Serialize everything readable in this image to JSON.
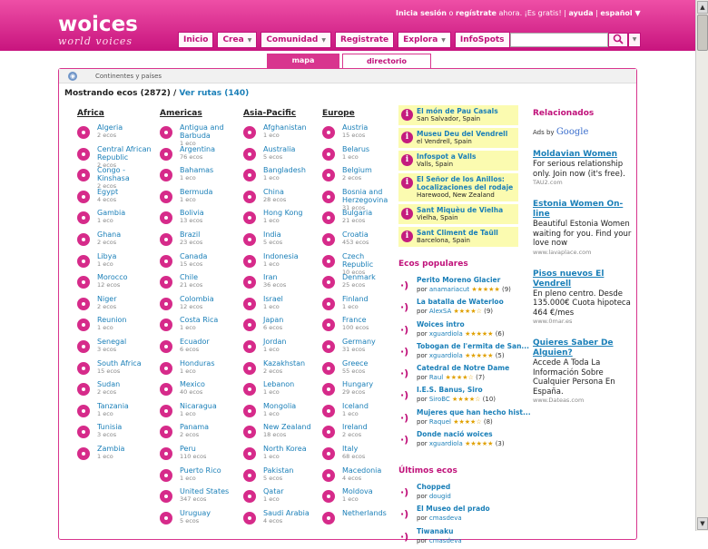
{
  "header": {
    "logo_main": "woices",
    "logo_sub": "world voices"
  },
  "toplinks": {
    "login": "Inicia sesión",
    "o": " o ",
    "register": "regístrate",
    "tail": " ahora. ¡Es gratis!",
    "sep1": " | ",
    "help": "ayuda",
    "sep2": " | ",
    "lang": "español ▼"
  },
  "nav": [
    {
      "label": "Inicio",
      "dd": false
    },
    {
      "label": "Crea",
      "dd": true
    },
    {
      "label": "Comunidad",
      "dd": true
    },
    {
      "label": "Registrate",
      "dd": false
    },
    {
      "label": "Explora",
      "dd": true
    },
    {
      "label": "InfoSpots",
      "dd": false
    }
  ],
  "search": {
    "value": "",
    "placeholder": ""
  },
  "tabs": {
    "map": "mapa",
    "directory": "directorio"
  },
  "breadcrumb": "Continentes y países",
  "summary": {
    "prefix": "Mostrando ecos (2872) / ",
    "link": "Ver rutas (140)"
  },
  "continents": [
    {
      "name": "Africa",
      "countries": [
        {
          "n": "Algeria",
          "c": "2 ecos"
        },
        {
          "n": "Central African Republic",
          "c": "2 ecos"
        },
        {
          "n": "Congo - Kinshasa",
          "c": "2 ecos"
        },
        {
          "n": "Egypt",
          "c": "4 ecos"
        },
        {
          "n": "Gambia",
          "c": "1 eco"
        },
        {
          "n": "Ghana",
          "c": "2 ecos"
        },
        {
          "n": "Libya",
          "c": "1 eco"
        },
        {
          "n": "Morocco",
          "c": "12 ecos"
        },
        {
          "n": "Niger",
          "c": "2 ecos"
        },
        {
          "n": "Reunion",
          "c": "1 eco"
        },
        {
          "n": "Senegal",
          "c": "3 ecos"
        },
        {
          "n": "South Africa",
          "c": "15 ecos"
        },
        {
          "n": "Sudan",
          "c": "2 ecos"
        },
        {
          "n": "Tanzania",
          "c": "1 eco"
        },
        {
          "n": "Tunisia",
          "c": "3 ecos"
        },
        {
          "n": "Zambia",
          "c": "1 eco"
        }
      ]
    },
    {
      "name": "Americas",
      "countries": [
        {
          "n": "Antigua and Barbuda",
          "c": "1 eco"
        },
        {
          "n": "Argentina",
          "c": "76 ecos"
        },
        {
          "n": "Bahamas",
          "c": "1 eco"
        },
        {
          "n": "Bermuda",
          "c": "1 eco"
        },
        {
          "n": "Bolivia",
          "c": "13 ecos"
        },
        {
          "n": "Brazil",
          "c": "23 ecos"
        },
        {
          "n": "Canada",
          "c": "15 ecos"
        },
        {
          "n": "Chile",
          "c": "21 ecos"
        },
        {
          "n": "Colombia",
          "c": "12 ecos"
        },
        {
          "n": "Costa Rica",
          "c": "1 eco"
        },
        {
          "n": "Ecuador",
          "c": "6 ecos"
        },
        {
          "n": "Honduras",
          "c": "1 eco"
        },
        {
          "n": "Mexico",
          "c": "40 ecos"
        },
        {
          "n": "Nicaragua",
          "c": "1 eco"
        },
        {
          "n": "Panama",
          "c": "2 ecos"
        },
        {
          "n": "Peru",
          "c": "110 ecos"
        },
        {
          "n": "Puerto Rico",
          "c": "1 eco"
        },
        {
          "n": "United States",
          "c": "347 ecos"
        },
        {
          "n": "Uruguay",
          "c": "5 ecos"
        }
      ]
    },
    {
      "name": "Asia-Pacific",
      "countries": [
        {
          "n": "Afghanistan",
          "c": "1 eco"
        },
        {
          "n": "Australia",
          "c": "5 ecos"
        },
        {
          "n": "Bangladesh",
          "c": "1 eco"
        },
        {
          "n": "China",
          "c": "28 ecos"
        },
        {
          "n": "Hong Kong",
          "c": "1 eco"
        },
        {
          "n": "India",
          "c": "5 ecos"
        },
        {
          "n": "Indonesia",
          "c": "1 eco"
        },
        {
          "n": "Iran",
          "c": "36 ecos"
        },
        {
          "n": "Israel",
          "c": "1 eco"
        },
        {
          "n": "Japan",
          "c": "6 ecos"
        },
        {
          "n": "Jordan",
          "c": "1 eco"
        },
        {
          "n": "Kazakhstan",
          "c": "2 ecos"
        },
        {
          "n": "Lebanon",
          "c": "1 eco"
        },
        {
          "n": "Mongolia",
          "c": "1 eco"
        },
        {
          "n": "New Zealand",
          "c": "18 ecos"
        },
        {
          "n": "North Korea",
          "c": "1 eco"
        },
        {
          "n": "Pakistan",
          "c": "5 ecos"
        },
        {
          "n": "Qatar",
          "c": "1 eco"
        },
        {
          "n": "Saudi Arabia",
          "c": "4 ecos"
        }
      ]
    },
    {
      "name": "Europe",
      "countries": [
        {
          "n": "Austria",
          "c": "15 ecos"
        },
        {
          "n": "Belarus",
          "c": "1 eco"
        },
        {
          "n": "Belgium",
          "c": "2 ecos"
        },
        {
          "n": "Bosnia and Herzegovina",
          "c": "31 ecos"
        },
        {
          "n": "Bulgaria",
          "c": "21 ecos"
        },
        {
          "n": "Croatia",
          "c": "453 ecos"
        },
        {
          "n": "Czech Republic",
          "c": "10 ecos"
        },
        {
          "n": "Denmark",
          "c": "25 ecos"
        },
        {
          "n": "Finland",
          "c": "1 eco"
        },
        {
          "n": "France",
          "c": "100 ecos"
        },
        {
          "n": "Germany",
          "c": "31 ecos"
        },
        {
          "n": "Greece",
          "c": "55 ecos"
        },
        {
          "n": "Hungary",
          "c": "29 ecos"
        },
        {
          "n": "Iceland",
          "c": "1 eco"
        },
        {
          "n": "Ireland",
          "c": "2 ecos"
        },
        {
          "n": "Italy",
          "c": "68 ecos"
        },
        {
          "n": "Macedonia",
          "c": "4 ecos"
        },
        {
          "n": "Moldova",
          "c": "1 eco"
        },
        {
          "n": "Netherlands",
          "c": ""
        }
      ]
    }
  ],
  "infospots": [
    {
      "t": "El món de Pau Casals",
      "l": "San Salvador, Spain"
    },
    {
      "t": "Museu Deu del Vendrell",
      "l": "el Vendrell, Spain"
    },
    {
      "t": "Infospot a Valls",
      "l": "Valls, Spain"
    },
    {
      "t": "El Señor de los Anillos: Localizaciones del rodaje",
      "l": "Harewood, New Zealand"
    },
    {
      "t": "Sant Miquèu de Vielha",
      "l": "Vielha, Spain"
    },
    {
      "t": "Sant Climent de Taüll",
      "l": "Barcelona, Spain"
    }
  ],
  "popular": {
    "title": "Ecos populares",
    "items": [
      {
        "t": "Perito Moreno Glacier",
        "by": "por",
        "u": "anamariacut",
        "s": "★★★★★",
        "n": "(9)"
      },
      {
        "t": "La batalla de Waterloo",
        "by": "por",
        "u": "AlexSA",
        "s": "★★★★☆",
        "n": "(9)"
      },
      {
        "t": "Woices intro",
        "by": "por",
        "u": "xguardiola",
        "s": "★★★★★",
        "n": "(6)"
      },
      {
        "t": "Tobogan de l'ermita de San...",
        "by": "por",
        "u": "xguardiola",
        "s": "★★★★★",
        "n": "(5)"
      },
      {
        "t": "Catedral de Notre Dame",
        "by": "por",
        "u": "Raul",
        "s": "★★★★☆",
        "n": "(7)"
      },
      {
        "t": "I.E.S. Banus, Siro",
        "by": "por",
        "u": "SiroBC",
        "s": "★★★★☆",
        "n": "(10)"
      },
      {
        "t": "Mujeres que han hecho hist...",
        "by": "por",
        "u": "Raquel",
        "s": "★★★★☆",
        "n": "(8)"
      },
      {
        "t": "Donde nació woices",
        "by": "por",
        "u": "xguardiola",
        "s": "★★★★★",
        "n": "(3)"
      }
    ]
  },
  "latest": {
    "title": "Últimos ecos",
    "items": [
      {
        "t": "Chopped",
        "by": "por",
        "u": "dougid"
      },
      {
        "t": "El Museo del prado",
        "by": "por",
        "u": "cmasdeva"
      },
      {
        "t": "Tiwanaku",
        "by": "por",
        "u": "cmasdeva"
      }
    ]
  },
  "related": {
    "title": "Relacionados",
    "ads_by": "Ads by",
    "google": "Google",
    "ads": [
      {
        "t": "Moldavian Women",
        "b": "For serious relationship only. Join now (it's free).",
        "u": "TAU2.com"
      },
      {
        "t": "Estonia Women On-line",
        "b": "Beautiful Estonia Women waiting for you. Find your love now",
        "u": "www.lavaplace.com"
      },
      {
        "t": "Pisos nuevos El Vendrell",
        "b": "En pleno centro. Desde 135.000€ Cuota hipoteca 464 €/mes",
        "u": "www.0mar.es"
      },
      {
        "t": "Quieres Saber De Alguien?",
        "b": "Accede A Toda La Información Sobre Cualquier Persona En España.",
        "u": "www.Dateas.com"
      }
    ]
  }
}
